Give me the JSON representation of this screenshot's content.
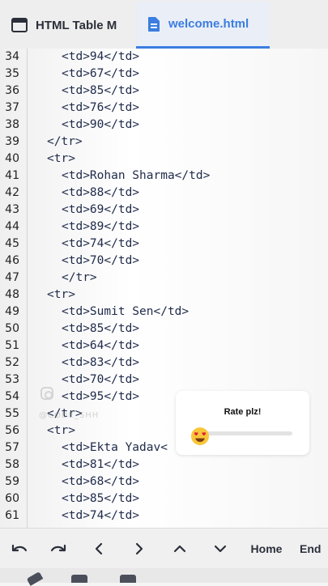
{
  "tabs": [
    {
      "label": "HTML Table M",
      "icon": "window-icon",
      "active": false
    },
    {
      "label": "welcome.html",
      "icon": "file-icon",
      "active": true
    }
  ],
  "accent_color": "#3b7de0",
  "code_lines": [
    {
      "num": "34",
      "indent": 2,
      "text": "<td>94</td>"
    },
    {
      "num": "35",
      "indent": 2,
      "text": "<td>67</td>"
    },
    {
      "num": "36",
      "indent": 2,
      "text": "<td>85</td>"
    },
    {
      "num": "37",
      "indent": 2,
      "text": "<td>76</td>"
    },
    {
      "num": "38",
      "indent": 2,
      "text": "<td>90</td>"
    },
    {
      "num": "39",
      "indent": 1,
      "text": "</tr>"
    },
    {
      "num": "40",
      "indent": 1,
      "text": "<tr>"
    },
    {
      "num": "41",
      "indent": 2,
      "text": "<td>Rohan Sharma</td>"
    },
    {
      "num": "42",
      "indent": 2,
      "text": "<td>88</td>"
    },
    {
      "num": "43",
      "indent": 2,
      "text": "<td>69</td>"
    },
    {
      "num": "44",
      "indent": 2,
      "text": "<td>89</td>"
    },
    {
      "num": "45",
      "indent": 2,
      "text": "<td>74</td>"
    },
    {
      "num": "46",
      "indent": 2,
      "text": "<td>70</td>"
    },
    {
      "num": "47",
      "indent": 2,
      "text": "</tr>"
    },
    {
      "num": "48",
      "indent": 1,
      "text": "<tr>"
    },
    {
      "num": "49",
      "indent": 2,
      "text": "<td>Sumit Sen</td>"
    },
    {
      "num": "50",
      "indent": 2,
      "text": "<td>85</td>"
    },
    {
      "num": "51",
      "indent": 2,
      "text": "<td>64</td>"
    },
    {
      "num": "52",
      "indent": 2,
      "text": "<td>83</td>"
    },
    {
      "num": "53",
      "indent": 2,
      "text": "<td>70</td>"
    },
    {
      "num": "54",
      "indent": 2,
      "text": "<td>95</td>"
    },
    {
      "num": "55",
      "indent": 1,
      "text": "</tr>"
    },
    {
      "num": "56",
      "indent": 1,
      "text": "<tr>"
    },
    {
      "num": "57",
      "indent": 2,
      "text": "<td>Ekta Yadav<"
    },
    {
      "num": "58",
      "indent": 2,
      "text": "<td>81</td>"
    },
    {
      "num": "59",
      "indent": 2,
      "text": "<td>68</td>"
    },
    {
      "num": "60",
      "indent": 2,
      "text": "<td>85</td>"
    },
    {
      "num": "61",
      "indent": 2,
      "text": "<td>74</td>"
    }
  ],
  "watermark": {
    "icon": "instagram-icon",
    "text": "@CODE_SHH"
  },
  "rating": {
    "title": "Rate plz!",
    "emoji": "heart-eyes-emoji-icon",
    "value": 0.15
  },
  "toolbar": {
    "buttons": [
      {
        "name": "undo-button",
        "icon": "undo-icon"
      },
      {
        "name": "redo-button",
        "icon": "redo-icon"
      },
      {
        "name": "left-arrow-button",
        "icon": "chevron-left-icon"
      },
      {
        "name": "right-arrow-button",
        "icon": "chevron-right-icon"
      },
      {
        "name": "up-arrow-button",
        "icon": "chevron-up-icon"
      },
      {
        "name": "down-arrow-button",
        "icon": "chevron-down-icon"
      }
    ],
    "home_label": "Home",
    "end_label": "End"
  }
}
